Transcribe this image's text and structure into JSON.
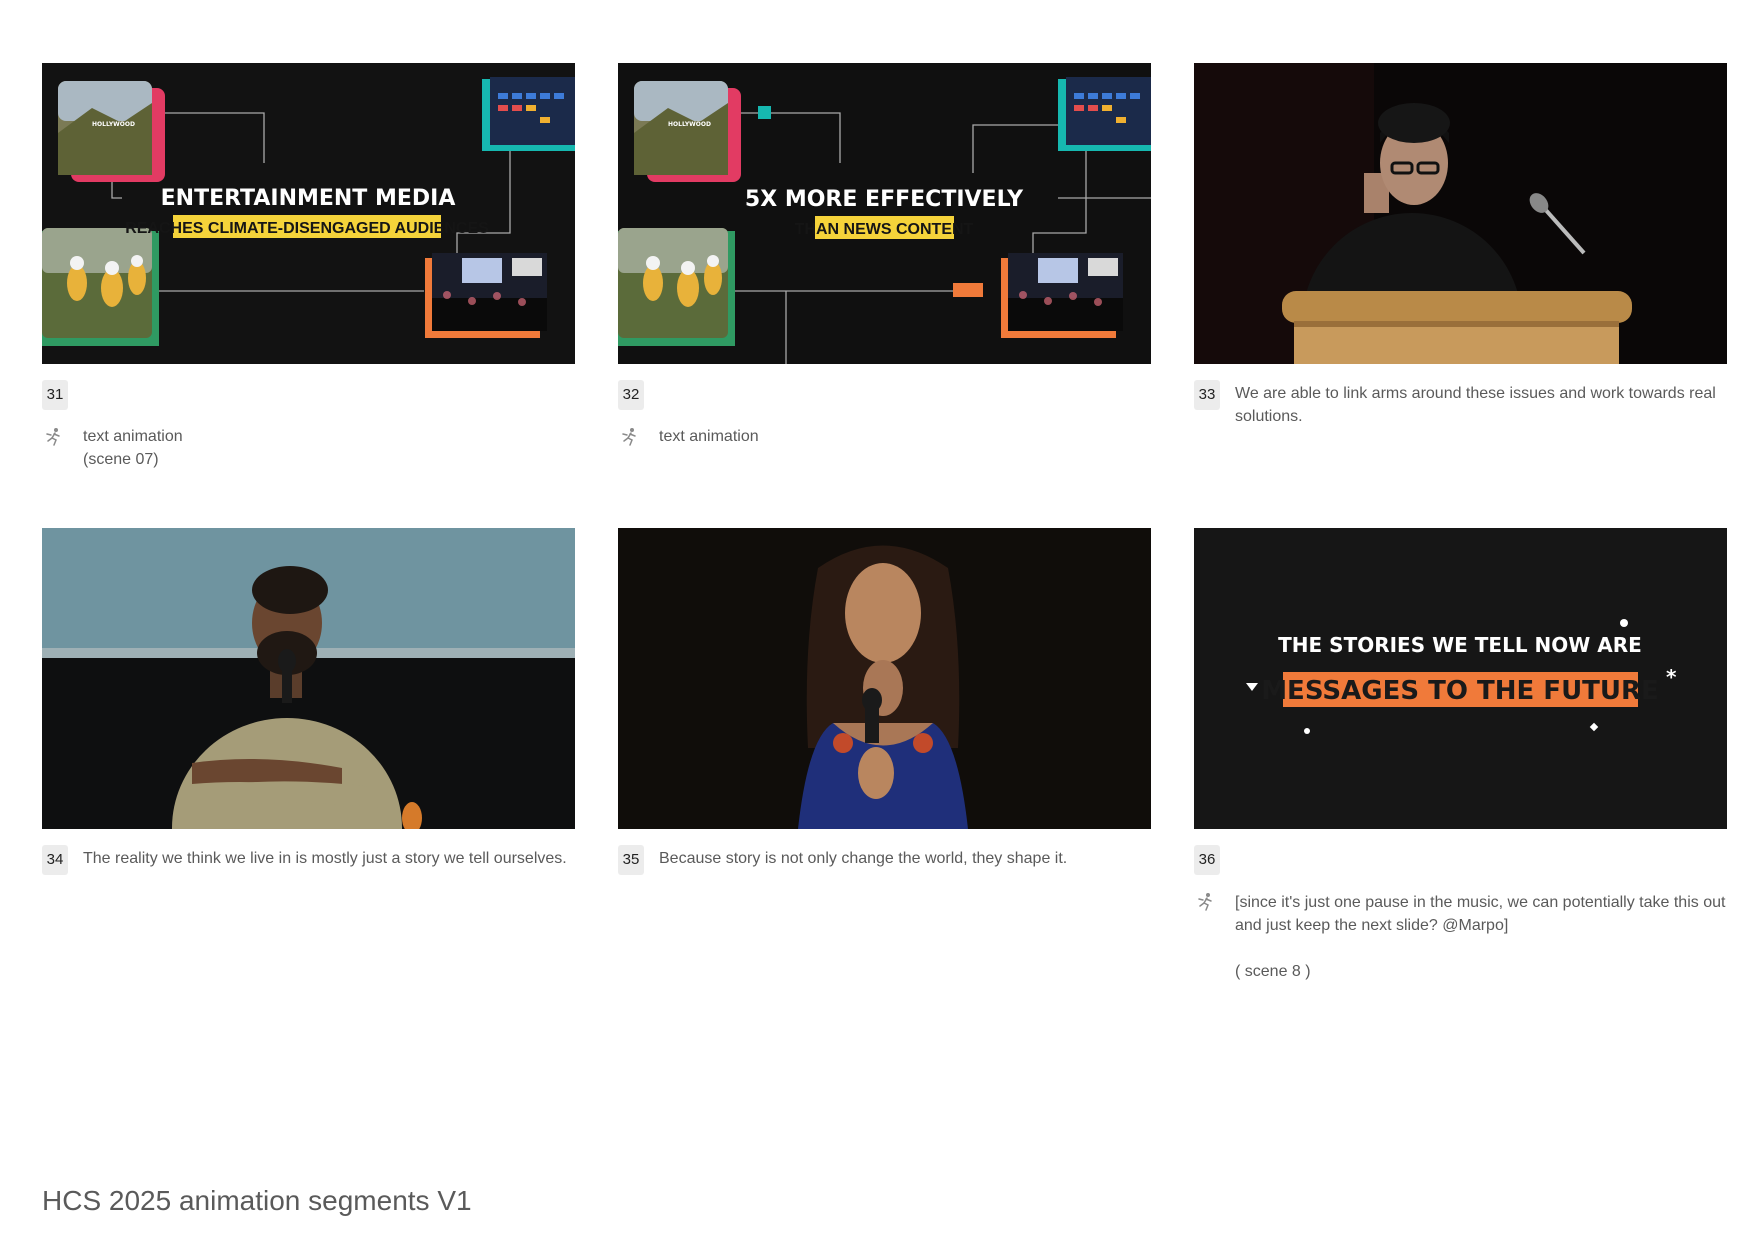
{
  "doc_title": "HCS 2025 animation segments V1",
  "icons": {
    "animation": "running-figure-icon"
  },
  "scenes": [
    {
      "number": "31",
      "overlay_title": "ENTERTAINMENT MEDIA",
      "overlay_subtitle": "REACHES CLIMATE-DISENGAGED AUDIENCES",
      "annotation": "text animation",
      "annotation_extra": "(scene 07)"
    },
    {
      "number": "32",
      "overlay_title": "5X MORE EFFECTIVELY",
      "overlay_subtitle": "THAN NEWS CONTENT",
      "annotation": "text animation"
    },
    {
      "number": "33",
      "caption_line1": "We are able to link arms around these issues and work towards real",
      "caption_line2": "solutions."
    },
    {
      "number": "34",
      "caption_line1": "The reality we think we live in is mostly just a story we tell ourselves."
    },
    {
      "number": "35",
      "caption_line1": "Because story is not only change the world, they shape it."
    },
    {
      "number": "36",
      "overlay_title": "THE STORIES WE TELL NOW ARE",
      "overlay_subtitle": "MESSAGES TO THE FUTURE",
      "annotation_line1": "[since it's just one pause in the music, we can potentially take this out",
      "annotation_line2": "and just keep the next slide? @Marpo]",
      "annotation_extra": "( scene 8 )"
    }
  ],
  "colors": {
    "accent_yellow": "#f5d33a",
    "accent_orange": "#f07a3a",
    "accent_teal": "#16b8b0",
    "accent_pink": "#e23b63",
    "accent_green": "#2f9a62"
  }
}
